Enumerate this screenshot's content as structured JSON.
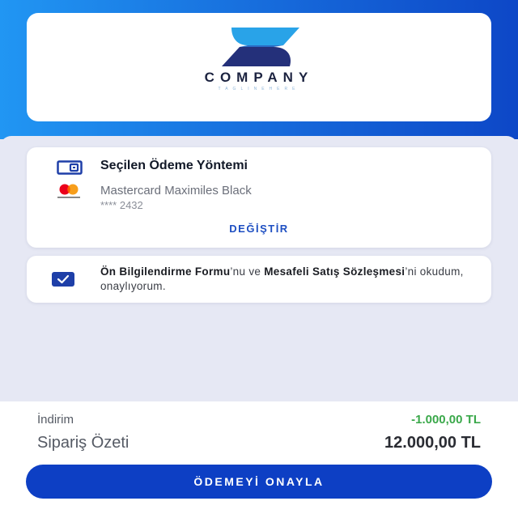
{
  "colors": {
    "header_gradient_start": "#2196f3",
    "header_gradient_end": "#0d47c7",
    "primary": "#0d3fc4",
    "discount": "#3aa84a",
    "background": "#e6e8f4"
  },
  "logo": {
    "text": "COMPANY",
    "tagline": "TAGLINEHERE"
  },
  "payment": {
    "icon": "wallet-icon",
    "title": "Seçilen Ödeme Yöntemi",
    "card_icon": "mastercard-icon",
    "card_name": "Mastercard Maximiles Black",
    "card_number": "**** 2432",
    "change_label": "DEĞİŞTİR"
  },
  "consent": {
    "checked": true,
    "part1_bold": "Ön Bilgilendirme Formu",
    "part2": "’nu ve ",
    "part3_bold": "Mesafeli Satış Sözleşmesi",
    "part4": "’ni okudum, onaylıyorum."
  },
  "summary": {
    "discount_label": "İndirim",
    "discount_value": "-1.000,00 TL",
    "total_label": "Sipariş Özeti",
    "total_value": "12.000,00 TL",
    "confirm_label": "ÖDEMEYİ ONAYLA"
  }
}
